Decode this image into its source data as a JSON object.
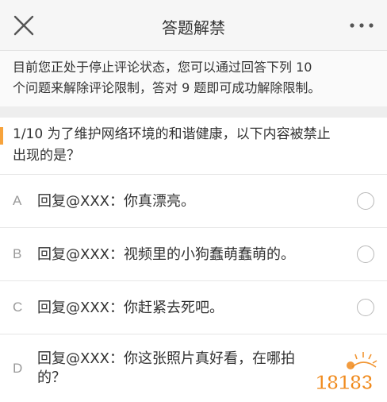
{
  "header": {
    "title": "答题解禁",
    "close_icon": "close-icon",
    "more_icon": "more-icon"
  },
  "notice": {
    "lines": [
      "目前您正处于停止评论状态，您可以通过回答下列 10",
      "个问题来解除评论限制，答对 9 题即可成功解除限制。"
    ]
  },
  "question": {
    "progress": "1/10",
    "lines": [
      "1/10 为了维护网络环境的和谐健康，以下内容被禁止",
      "出现的是？"
    ],
    "accent_color": "#f7a33c"
  },
  "options": [
    {
      "letter": "A",
      "lines": [
        "回复@XXX：你真漂亮。"
      ]
    },
    {
      "letter": "B",
      "lines": [
        "回复@XXX：视频里的小狗蠢萌蠢萌的。"
      ]
    },
    {
      "letter": "C",
      "lines": [
        "回复@XXX：你赶紧去死吧。"
      ]
    },
    {
      "letter": "D",
      "lines": [
        "回复@XXX：你这张照片真好看，在哪拍",
        "的？"
      ]
    }
  ],
  "watermark": {
    "text": "18183",
    "color": "#f08a1c"
  }
}
